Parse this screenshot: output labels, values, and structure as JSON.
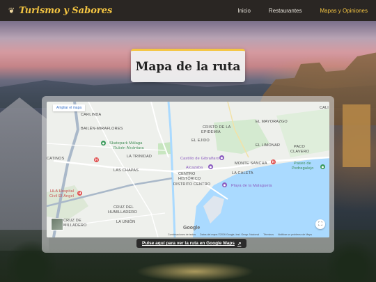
{
  "brand": {
    "name": "Turismo y Sabores",
    "icon": "star-icon"
  },
  "nav": {
    "items": [
      {
        "label": "Inicio"
      },
      {
        "label": "Restaurantes"
      },
      {
        "label": "Mapas y Opiniones"
      }
    ],
    "active_index": 2
  },
  "page": {
    "title": "Mapa de la ruta"
  },
  "map": {
    "enlarge_label": "Ampliar el mapa",
    "labels": {
      "carlinda": "CARLINDA",
      "cali": "CALI",
      "bailen": "BAILÉN-MIRAFLORES",
      "cristo": "CRISTO DE LA",
      "epidemia": "EPIDEMIA",
      "ejido": "EL EJIDO",
      "mayorazgo": "EL MAYORAZGO",
      "skatepark1": "Skatepark Málaga",
      "skatepark2": "Rubén Alcántara",
      "limonar": "EL LIMONAR",
      "paco": "PACO",
      "claveros": "CLAVERO",
      "catinos": "CATINOS",
      "trinidad": "LA TRINIDAD",
      "gibralfaro": "Castillo de Gibralfaro",
      "monte_sancha": "MONTE SANCHA",
      "chapas": "LAS CHAPAS",
      "alcazaba": "Alcazaba",
      "paseo": "Paseo de",
      "pedregalejo": "Pedregalejo",
      "centro1": "CENTRO",
      "centro2": "HISTÓRICO",
      "caleta": "LA CALETA",
      "distrito": "DISTRITO CENTRO",
      "playa": "Playa de la Malagueta",
      "hla1": "HLA Hospital",
      "hla2": "Civil El Ángel",
      "cruz1": "CRUZ DEL",
      "cruz2": "HUMILLADERO",
      "cruz3": "CRUZ DE",
      "cruz4": "MILLADERO",
      "union": "LA UNIÓN",
      "google": "Google"
    },
    "attribution": [
      "Combinaciones de teclas",
      "Datos del mapa ©2026 Google, Inst. Geogr. Nacional",
      "Términos",
      "Notificar un problema de Maps"
    ],
    "colors": {
      "water": "#aadaff",
      "park": "#c8e6c0",
      "road": "#ffffff",
      "highway": "#a9b8c9",
      "accent": "#f4c542"
    }
  },
  "cta": {
    "label": "Pulse aquí para ver la ruta en Google Maps",
    "icon": "external-link-icon"
  }
}
